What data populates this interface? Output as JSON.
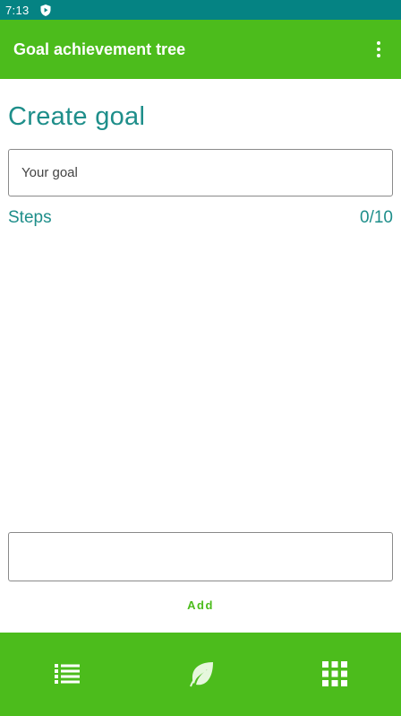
{
  "status_bar": {
    "time": "7:13",
    "icon": "shield-play-icon"
  },
  "app_bar": {
    "title": "Goal achievement tree",
    "menu_icon": "more-vert-icon"
  },
  "main": {
    "page_title": "Create goal",
    "goal_input": {
      "placeholder": "Your goal",
      "value": ""
    },
    "steps_label": "Steps",
    "steps_count": "0/10",
    "step_input": {
      "placeholder": "",
      "value": ""
    },
    "add_label": "Add"
  },
  "bottom_nav": {
    "items": [
      {
        "icon": "list-icon"
      },
      {
        "icon": "leaf-icon"
      },
      {
        "icon": "apps-grid-icon"
      }
    ]
  },
  "colors": {
    "status_bar": "#058383",
    "primary": "#4cbc1c",
    "accent_text": "#1e8e8a"
  }
}
